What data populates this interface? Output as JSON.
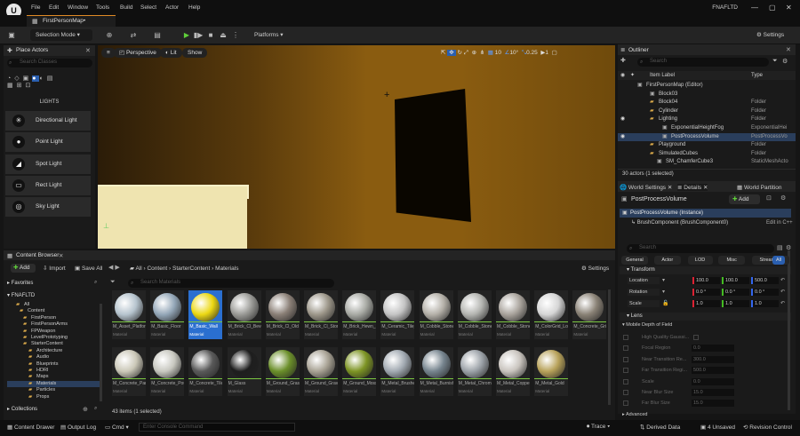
{
  "title_bar": {
    "logo": "U",
    "menus": [
      "File",
      "Edit",
      "Window",
      "Tools",
      "Build",
      "Select",
      "Actor",
      "Help"
    ],
    "project": "FNAFLTD"
  },
  "tab": {
    "label": "FirstPersonMap•"
  },
  "toolbar": {
    "mode": "Selection Mode",
    "platforms": "Platforms",
    "settings": "Settings"
  },
  "place_actors": {
    "title": "Place Actors",
    "search_placeholder": "Search Classes",
    "category": "LIGHTS",
    "items": [
      "Directional Light",
      "Point Light",
      "Spot Light",
      "Rect Light",
      "Sky Light"
    ]
  },
  "viewport": {
    "perspective": "Perspective",
    "lit": "Lit",
    "show": "Show",
    "grid": "10",
    "angle": "10°",
    "scale": "0.25",
    "cam": "1"
  },
  "outliner": {
    "title": "Outliner",
    "search_placeholder": "Search",
    "col_label": "Item Label",
    "col_type": "Type",
    "rows": [
      {
        "label": "FirstPersonMap (Editor)",
        "type": ""
      },
      {
        "label": "Block03",
        "type": ""
      },
      {
        "label": "Block04",
        "type": "Folder"
      },
      {
        "label": "Cylinder",
        "type": "Folder"
      },
      {
        "label": "Lighting",
        "type": "Folder"
      },
      {
        "label": "ExponentialHeightFog",
        "type": "ExponentialHei"
      },
      {
        "label": "PostProcessVolume",
        "type": "PostProcessVo"
      },
      {
        "label": "Playground",
        "type": "Folder"
      },
      {
        "label": "SimulatedCubes",
        "type": "Folder"
      },
      {
        "label": "SM_ChamferCube3",
        "type": "StaticMeshActo"
      }
    ],
    "count": "30 actors (1 selected)"
  },
  "details": {
    "tabs": [
      "World Settings",
      "Details",
      "World Partition"
    ],
    "object": "PostProcessVolume",
    "add": "Add",
    "instance": "PostProcessVolume (Instance)",
    "component": "BrushComponent (BrushComponent0)",
    "edit_cpp": "Edit in C++",
    "search_placeholder": "Search",
    "filters": [
      "General",
      "Actor",
      "LOD",
      "Misc",
      "Streaming",
      "All"
    ],
    "transform": "Transform",
    "location": {
      "label": "Location",
      "x": "100.0",
      "y": "100.0",
      "z": "500.0"
    },
    "rotation": {
      "label": "Rotation",
      "x": "0.0 °",
      "y": "0.0 °",
      "z": "0.0 °"
    },
    "scale": {
      "label": "Scale",
      "x": "1.0",
      "y": "1.0",
      "z": "1.0"
    },
    "lens": "Lens",
    "mdof": "Mobile Depth of Field",
    "rows": [
      {
        "label": "High Quality Gaussi...",
        "value": ""
      },
      {
        "label": "Focal Region",
        "value": "0.0"
      },
      {
        "label": "Near Transition Re...",
        "value": "300.0"
      },
      {
        "label": "Far Transition Regi...",
        "value": "500.0"
      },
      {
        "label": "Scale",
        "value": "0.0"
      },
      {
        "label": "Near Blur Size",
        "value": "15.0"
      },
      {
        "label": "Far Blur Size",
        "value": "15.0"
      }
    ],
    "advanced": "Advanced"
  },
  "content_browser": {
    "title": "Content Browser",
    "add": "Add",
    "import": "Import",
    "save_all": "Save All",
    "breadcrumb": [
      "All",
      "Content",
      "StarterContent",
      "Materials"
    ],
    "settings": "Settings",
    "favorites": "Favorites",
    "project": "FNAFLTD",
    "search_placeholder": "Search Materials",
    "tree": [
      "All",
      "Content",
      "FirstPerson",
      "FirstPersonArms",
      "FPWeapon",
      "LevelPrototyping",
      "StarterContent",
      "Architecture",
      "Audio",
      "Blueprints",
      "HDRI",
      "Maps",
      "Materials",
      "Particles",
      "Props"
    ],
    "collections": "Collections",
    "count": "43 items (1 selected)",
    "assets": [
      {
        "name": "M_Asset_Platform",
        "type": "Material",
        "color": "#b6c4ce"
      },
      {
        "name": "M_Basic_Floor",
        "type": "Material",
        "color": "#94a7b8"
      },
      {
        "name": "M_Basic_Wall",
        "type": "Material",
        "color": "#ecd813"
      },
      {
        "name": "M_Brick_Cl_Beveled",
        "type": "Material",
        "color": "#9a9a96"
      },
      {
        "name": "M_Brick_Cl_Old",
        "type": "Material",
        "color": "#8a7f76"
      },
      {
        "name": "M_Brick_Cl_Stone",
        "type": "Material",
        "color": "#9d978a"
      },
      {
        "name": "M_Brick_Hewn_Stone",
        "type": "Material",
        "color": "#a8aaa4"
      },
      {
        "name": "M_Ceramic_Tile_Checker",
        "type": "Material",
        "color": "#c4c4c4"
      },
      {
        "name": "M_Cobble_Stone_Pebble",
        "type": "Material",
        "color": "#b4b0a8"
      },
      {
        "name": "M_Cobble_Stone_Rough",
        "type": "Material",
        "color": "#b3b4b0"
      },
      {
        "name": "M_Cobble_Stone_Smooth",
        "type": "Material",
        "color": "#a9a39c"
      },
      {
        "name": "M_ColorGrid_LowSpec",
        "type": "Material",
        "color": "#d6d6d6"
      },
      {
        "name": "M_Concrete_Grime",
        "type": "Material",
        "color": "#8a8276"
      },
      {
        "name": "M_Concrete_Panels",
        "type": "Material",
        "color": "#cbc8b8"
      },
      {
        "name": "M_Concrete_Poured",
        "type": "Material",
        "color": "#c8c8c0"
      },
      {
        "name": "M_Concrete_Tiles",
        "type": "Material",
        "color": "#595959"
      },
      {
        "name": "M_Glass",
        "type": "Material",
        "color": "#1e1e1e"
      },
      {
        "name": "M_Ground_Grass",
        "type": "Material",
        "color": "#6b8f2a"
      },
      {
        "name": "M_Ground_Gravel",
        "type": "Material",
        "color": "#a8a294"
      },
      {
        "name": "M_Ground_Moss",
        "type": "Material",
        "color": "#7d9424"
      },
      {
        "name": "M_Metal_Brushed",
        "type": "Material",
        "color": "#a2aab2"
      },
      {
        "name": "M_Metal_Burnished",
        "type": "Material",
        "color": "#76848e"
      },
      {
        "name": "M_Metal_Chrome",
        "type": "Material",
        "color": "#9ca2a8"
      },
      {
        "name": "M_Metal_Copper",
        "type": "Material",
        "color": "#c9c4be"
      },
      {
        "name": "M_Metal_Gold",
        "type": "Material",
        "color": "#b8a25a"
      }
    ]
  },
  "status": {
    "content_drawer": "Content Drawer",
    "output_log": "Output Log",
    "cmd": "Cmd",
    "console_placeholder": "Enter Console Command",
    "trace": "Trace",
    "derived": "Derived Data",
    "unsaved": "4 Unsaved",
    "revision": "Revision Control"
  }
}
